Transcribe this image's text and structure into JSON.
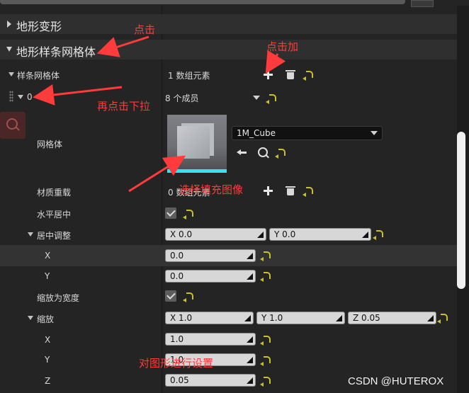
{
  "sections": {
    "terrain_deform": "地形变形",
    "spline_mesh": "地形样条网格体"
  },
  "rows": {
    "spline_meshes": {
      "label": "样条网格体",
      "value": "1 数组元素"
    },
    "element0": {
      "label": "0",
      "value": "8 个成员"
    },
    "mesh": {
      "label": "网格体",
      "asset": "1M_Cube"
    },
    "material_override": {
      "label": "材质重载",
      "value": "0 数组元素"
    },
    "center_h": {
      "label": "水平居中"
    },
    "center_adjust": {
      "label": "居中调整",
      "x": "X  0.0",
      "y": "Y  0.0"
    },
    "ca_x": {
      "label": "X",
      "value": "0.0"
    },
    "ca_y": {
      "label": "Y",
      "value": "0.0"
    },
    "scale_to_width": {
      "label": "缩放为宽度"
    },
    "scale": {
      "label": "缩放",
      "x": "X  1.0",
      "y": "Y  1.0",
      "z": "Z  0.05"
    },
    "sc_x": {
      "label": "X",
      "value": "1.0"
    },
    "sc_y": {
      "label": "Y",
      "value": "1.0"
    },
    "sc_z": {
      "label": "Z",
      "value": "0.05"
    }
  },
  "annotations": {
    "click": "点击",
    "click_add": "点击加",
    "click_dropdown": "再点击下拉",
    "choose_image": "选择填充图像",
    "set_image": "对图形进行设置"
  },
  "watermark": "CSDN @HUTEROX",
  "colors": {
    "reset": "#c9c12b",
    "annotation": "#ff3b3b",
    "thumb_bar": "#35e3f0"
  },
  "icons": [
    "search-icon",
    "plus-icon",
    "trash-icon",
    "reset-arrow-icon",
    "back-arrow-icon",
    "browse-icon",
    "drag-handle-icon",
    "dropdown-arrow-icon"
  ]
}
